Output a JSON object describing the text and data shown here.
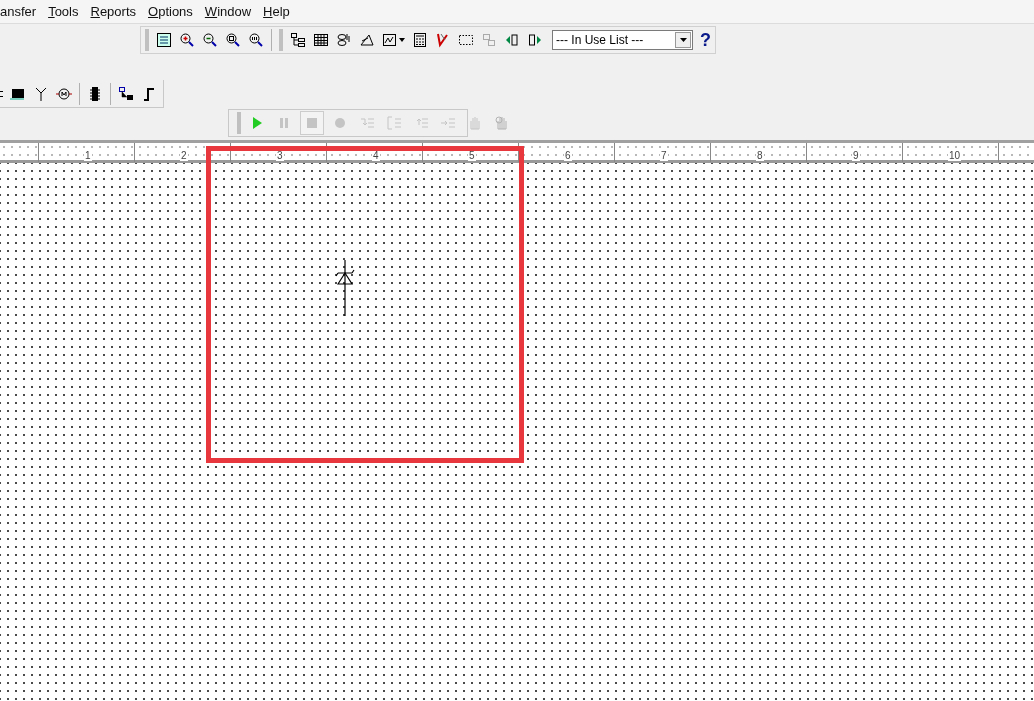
{
  "menu_bar": [
    {
      "label": "ansfer",
      "mnemonic": false
    },
    {
      "label": "Tools",
      "mnemonic": true
    },
    {
      "label": "Reports",
      "mnemonic": true
    },
    {
      "label": "Options",
      "mnemonic": true
    },
    {
      "label": "Window",
      "mnemonic": true
    },
    {
      "label": "Help",
      "mnemonic": true
    }
  ],
  "in_use_list": {
    "value": "--- In Use List ---"
  },
  "help_button": "?",
  "simulation_toolbar": [
    {
      "disabled": false
    },
    {
      "disabled": true
    },
    {
      "disabled": true
    },
    {
      "disabled": true
    },
    {
      "disabled": true
    },
    {
      "disabled": true
    },
    {
      "disabled": true
    },
    {
      "disabled": true
    },
    {
      "disabled": true
    },
    {
      "disabled": true
    }
  ],
  "ruler": [
    "1",
    "2",
    "3",
    "4",
    "5",
    "6",
    "7",
    "8",
    "9",
    "10"
  ]
}
